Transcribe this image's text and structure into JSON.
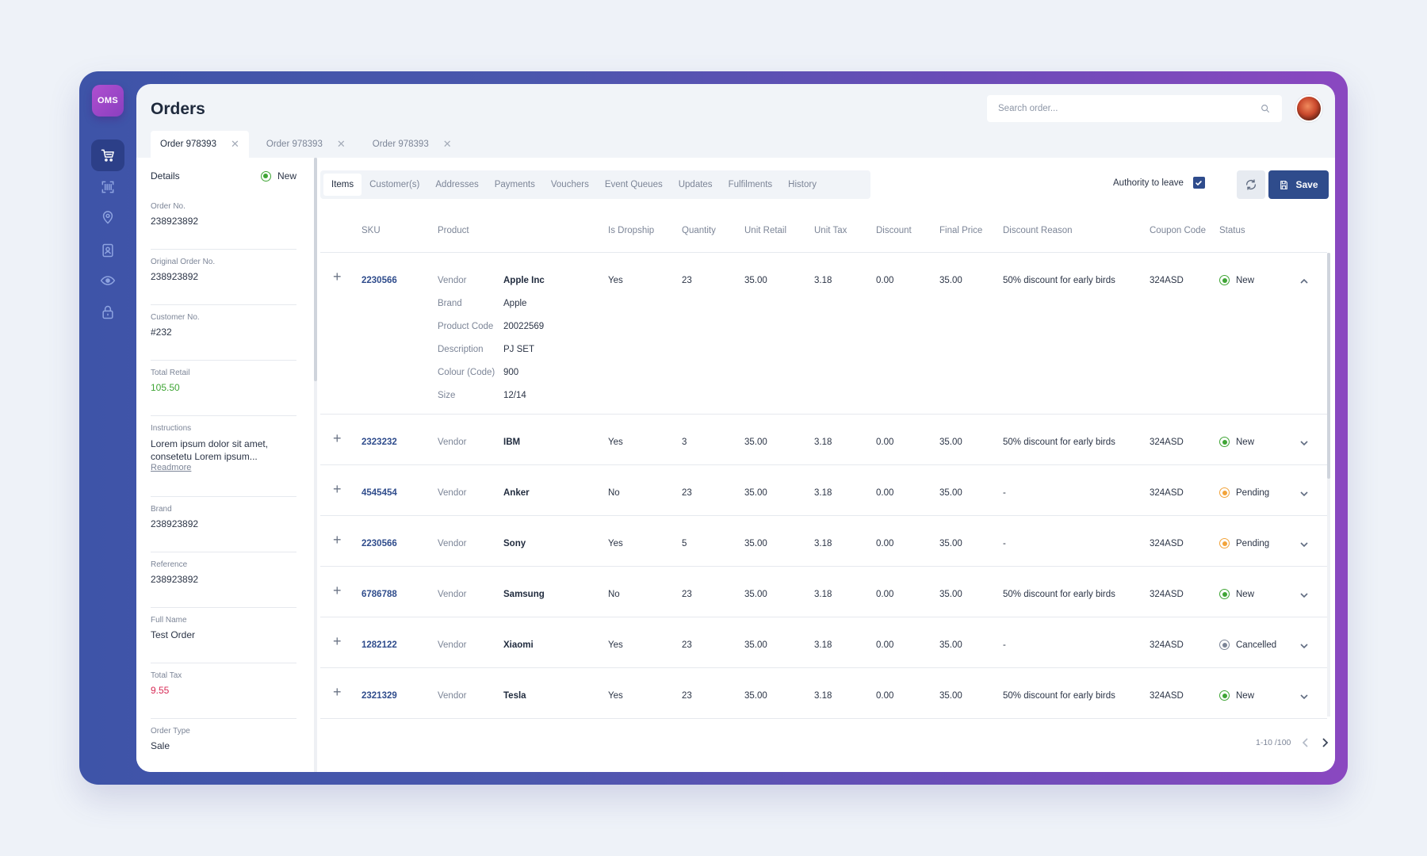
{
  "app": {
    "logo": "OMS",
    "page_title": "Orders",
    "search": {
      "placeholder": "Search order..."
    }
  },
  "rail": {
    "items": [
      {
        "icon": "cart-icon",
        "active": true
      },
      {
        "icon": "barcode-scan-icon",
        "active": false
      },
      {
        "icon": "location-pin-icon",
        "active": false
      },
      {
        "icon": "contact-card-icon",
        "active": false
      },
      {
        "icon": "eye-icon",
        "active": false
      },
      {
        "icon": "lock-icon",
        "active": false
      }
    ]
  },
  "doc_tabs": [
    {
      "label": "Order 978393",
      "active": true
    },
    {
      "label": "Order 978393",
      "active": false
    },
    {
      "label": "Order 978393",
      "active": false
    }
  ],
  "details": {
    "title": "Details",
    "status": "New",
    "fields": [
      {
        "label": "Order No.",
        "value": "238923892"
      },
      {
        "label": "Original Order No.",
        "value": "238923892"
      },
      {
        "label": "Customer No.",
        "value": "#232"
      },
      {
        "label": "Total Retail",
        "value": "105.50"
      },
      {
        "label": "Instructions",
        "value": "Lorem ipsum dolor sit amet, consetetu Lorem ipsum...",
        "link": "Readmore"
      },
      {
        "label": "Brand",
        "value": "238923892"
      },
      {
        "label": "Reference",
        "value": "238923892"
      },
      {
        "label": "Full Name",
        "value": "Test Order"
      },
      {
        "label": "Total Tax",
        "value": "9.55"
      },
      {
        "label": "Order Type",
        "value": "Sale"
      }
    ]
  },
  "subtabs": [
    "Items",
    "Customer(s)",
    "Addresses",
    "Payments",
    "Vouchers",
    "Event Queues",
    "Updates",
    "Fulfilments",
    "History"
  ],
  "toolbar": {
    "authority_label": "Authority to leave",
    "authority_checked": true,
    "save_label": "Save"
  },
  "table": {
    "columns": [
      "SKU",
      "Product",
      "Is Dropship",
      "Quantity",
      "Unit Retail",
      "Unit Tax",
      "Discount",
      "Final Price",
      "Discount Reason",
      "Coupon Code",
      "Status"
    ],
    "vendor_label": "Vendor",
    "expanded_attributes": [
      {
        "label": "Brand",
        "value": "Apple"
      },
      {
        "label": "Product Code",
        "value": "20022569"
      },
      {
        "label": "Description",
        "value": "PJ SET"
      },
      {
        "label": "Colour (Code)",
        "value": "900"
      },
      {
        "label": "Size",
        "value": "12/14"
      }
    ],
    "rows": [
      {
        "sku": "2230566",
        "vendor": "Apple Inc",
        "dropship": "Yes",
        "qty": "23",
        "retail": "35.00",
        "tax": "3.18",
        "discount": "0.00",
        "final": "35.00",
        "reason": "50% discount for early birds",
        "coupon": "324ASD",
        "status": "New",
        "status_color": "#3fa535"
      },
      {
        "sku": "2323232",
        "vendor": "IBM",
        "dropship": "Yes",
        "qty": "3",
        "retail": "35.00",
        "tax": "3.18",
        "discount": "0.00",
        "final": "35.00",
        "reason": "50% discount for early birds",
        "coupon": "324ASD",
        "status": "New",
        "status_color": "#3fa535"
      },
      {
        "sku": "4545454",
        "vendor": "Anker",
        "dropship": "No",
        "qty": "23",
        "retail": "35.00",
        "tax": "3.18",
        "discount": "0.00",
        "final": "35.00",
        "reason": "-",
        "coupon": "324ASD",
        "status": "Pending",
        "status_color": "#f2a33a"
      },
      {
        "sku": "2230566",
        "vendor": "Sony",
        "dropship": "Yes",
        "qty": "5",
        "retail": "35.00",
        "tax": "3.18",
        "discount": "0.00",
        "final": "35.00",
        "reason": "-",
        "coupon": "324ASD",
        "status": "Pending",
        "status_color": "#f2a33a"
      },
      {
        "sku": "6786788",
        "vendor": "Samsung",
        "dropship": "No",
        "qty": "23",
        "retail": "35.00",
        "tax": "3.18",
        "discount": "0.00",
        "final": "35.00",
        "reason": "50% discount for early birds",
        "coupon": "324ASD",
        "status": "New",
        "status_color": "#3fa535"
      },
      {
        "sku": "1282122",
        "vendor": "Xiaomi",
        "dropship": "Yes",
        "qty": "23",
        "retail": "35.00",
        "tax": "3.18",
        "discount": "0.00",
        "final": "35.00",
        "reason": "-",
        "coupon": "324ASD",
        "status": "Cancelled",
        "status_color": "#7c8597"
      },
      {
        "sku": "2321329",
        "vendor": "Tesla",
        "dropship": "Yes",
        "qty": "23",
        "retail": "35.00",
        "tax": "3.18",
        "discount": "0.00",
        "final": "35.00",
        "reason": "50% discount for early birds",
        "coupon": "324ASD",
        "status": "New",
        "status_color": "#3fa535"
      }
    ]
  },
  "pager": {
    "range": "1-10 /100"
  },
  "colors": {
    "accent": "#2f4c8c",
    "green": "#3fa535",
    "red": "#d72a55",
    "orange": "#f2a33a",
    "grey": "#7c8597"
  }
}
